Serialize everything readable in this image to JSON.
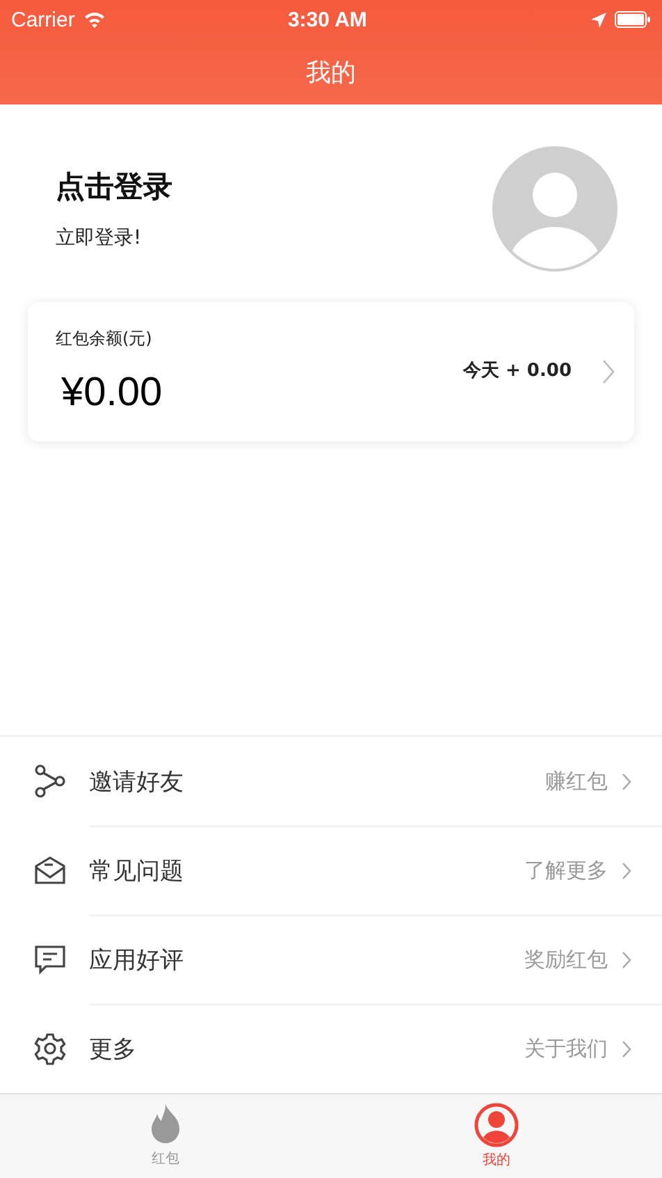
{
  "status_bar": {
    "carrier": "Carrier",
    "time": "3:30 AM"
  },
  "nav": {
    "title": "我的"
  },
  "profile": {
    "title": "点击登录",
    "subtitle": "立即登录!"
  },
  "wallet": {
    "label": "红包余额(元)",
    "amount": "¥0.00",
    "today": "今天 + 0.00"
  },
  "menu": [
    {
      "kind": "share",
      "label": "邀请好友",
      "detail": "赚红包"
    },
    {
      "kind": "mail",
      "label": "常见问题",
      "detail": "了解更多"
    },
    {
      "kind": "comment",
      "label": "应用好评",
      "detail": "奖励红包"
    },
    {
      "kind": "gear",
      "label": "更多",
      "detail": "关于我们"
    }
  ],
  "tabs": [
    {
      "kind": "flame",
      "label": "红包",
      "selected": false
    },
    {
      "kind": "user",
      "label": "我的",
      "selected": true
    }
  ]
}
